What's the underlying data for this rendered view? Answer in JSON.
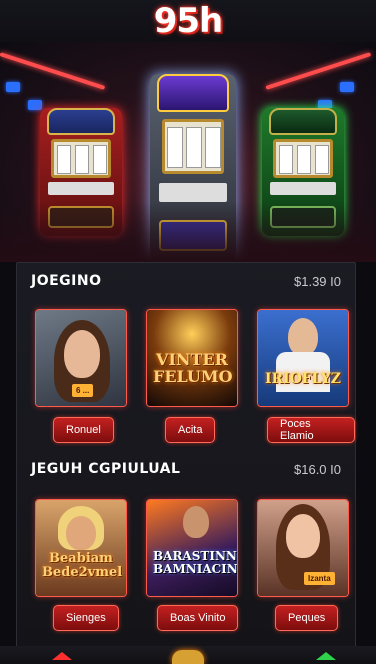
{
  "header": {
    "logo_text": "95h"
  },
  "sections": [
    {
      "title": "JOEGINO",
      "amount": "$1.39 I0",
      "games": [
        {
          "art_label": "",
          "chip_text": "6 ...",
          "button_label": "Ronuel"
        },
        {
          "art_label": "VINTER FELUMO",
          "chip_text": "",
          "button_label": "Acita"
        },
        {
          "art_label": "IRIOFLYZ",
          "chip_text": "",
          "button_label": "Poces Elamio"
        }
      ]
    },
    {
      "title": "JEGUH CGPIULUAL",
      "amount": "$16.0 I0",
      "games": [
        {
          "art_label": "Beabiam Bede2vmel",
          "chip_text": "",
          "button_label": "Sienges"
        },
        {
          "art_label": "BARASTINNEL BAMNIACING",
          "chip_text": "",
          "button_label": "Boas Vinito"
        },
        {
          "art_label": "",
          "chip_text": "Izanta",
          "button_label": "Peques"
        }
      ]
    }
  ],
  "colors": {
    "accent": "#ff3b2f",
    "button": "#c42020",
    "green": "#2fd34a"
  },
  "icons": [
    "left-arrow-icon",
    "home-icon",
    "right-arrow-icon"
  ]
}
